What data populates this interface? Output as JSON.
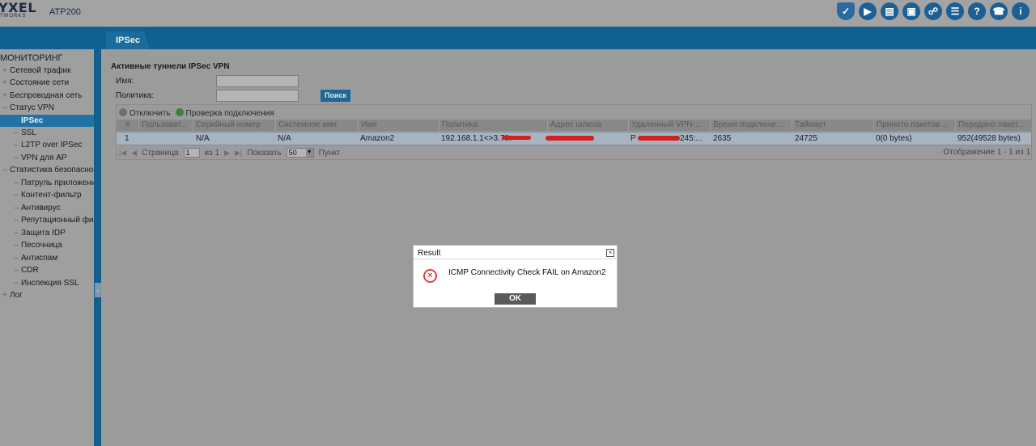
{
  "header": {
    "logo_line1": "YXEL",
    "logo_line2": "TWORKS",
    "model": "ATP200",
    "icons": [
      "shield-icon",
      "console-icon",
      "cli-icon",
      "monitor-icon",
      "network-icon",
      "chat-icon",
      "help-icon",
      "support-icon",
      "info-icon"
    ],
    "icon_glyphs": [
      "✓",
      "▶",
      "▤",
      "▣",
      "☍",
      "☰",
      "?",
      "☎",
      "i"
    ]
  },
  "tab": {
    "label": "IPSec"
  },
  "sidebar": {
    "title": "МОНИТОРИНГ",
    "items": [
      {
        "label": "Сетевой трафик",
        "prefix": "+"
      },
      {
        "label": "Состояние сети",
        "prefix": "+"
      },
      {
        "label": "Беспроводная сеть",
        "prefix": "+"
      },
      {
        "label": "Статус VPN",
        "prefix": "–"
      },
      {
        "label": "IPSec",
        "prefix": ""
      },
      {
        "label": "SSL",
        "prefix": "–"
      },
      {
        "label": "L2TP over IPSec",
        "prefix": "–"
      },
      {
        "label": "VPN для AP",
        "prefix": "–"
      },
      {
        "label": "Статистика безопасности",
        "prefix": "–"
      },
      {
        "label": "Патруль приложений",
        "prefix": "–"
      },
      {
        "label": "Контент-фильтр",
        "prefix": "–"
      },
      {
        "label": "Антивирус",
        "prefix": "–"
      },
      {
        "label": "Репутационный фильтр",
        "prefix": "–"
      },
      {
        "label": "Защита IDP",
        "prefix": "–"
      },
      {
        "label": "Песочница",
        "prefix": "–"
      },
      {
        "label": "Антиспам",
        "prefix": "–"
      },
      {
        "label": "CDR",
        "prefix": "–"
      },
      {
        "label": "Инспекция SSL",
        "prefix": "–"
      },
      {
        "label": "Лог",
        "prefix": "+"
      }
    ],
    "collapse_glyph": "‹"
  },
  "panel": {
    "title": "Активные туннели IPSec VPN",
    "name_label": "Имя:",
    "name_value": "",
    "policy_label": "Политика:",
    "policy_value": "",
    "search_label": "Поиск"
  },
  "toolbar": {
    "disconnect_label": "Отключить",
    "check_label": "Проверка подключения"
  },
  "table": {
    "columns": [
      "#",
      "Пользоват...",
      "Серийный номер",
      "Системное имя",
      "Имя",
      "Политика",
      "Адрес шлюза",
      "Удаленный VPN-...",
      "Время подключе...",
      "Таймаут",
      "Принято пакетов ...",
      "Передано пакет..."
    ],
    "rows": [
      [
        "1",
        "",
        "N/A",
        "N/A",
        "Amazon2",
        "192.168.1.1<>3.70.",
        "",
        "P",
        "2635",
        "24725",
        "0(0 bytes)",
        "952(49528 bytes)"
      ]
    ],
    "remote_suffix": "245:..."
  },
  "pager": {
    "first": "|◀",
    "prev": "◀",
    "page_label": "Страница",
    "page_value": "1",
    "of_label": "из 1",
    "next": "▶",
    "last": "▶|",
    "show_label": "Показать",
    "page_size": "50",
    "items_label": "Пункт",
    "info": "Отображение 1 - 1 из 1"
  },
  "dialog": {
    "title": "Result",
    "message": "ICMP Connectivity Check FAIL on Amazon2",
    "ok_label": "OK",
    "close_glyph": "×",
    "error_glyph": "×"
  },
  "colors": {
    "brand_blue": "#0f6192",
    "active_item": "#2173a6",
    "error": "#e0413c",
    "redaction": "#d02020"
  }
}
